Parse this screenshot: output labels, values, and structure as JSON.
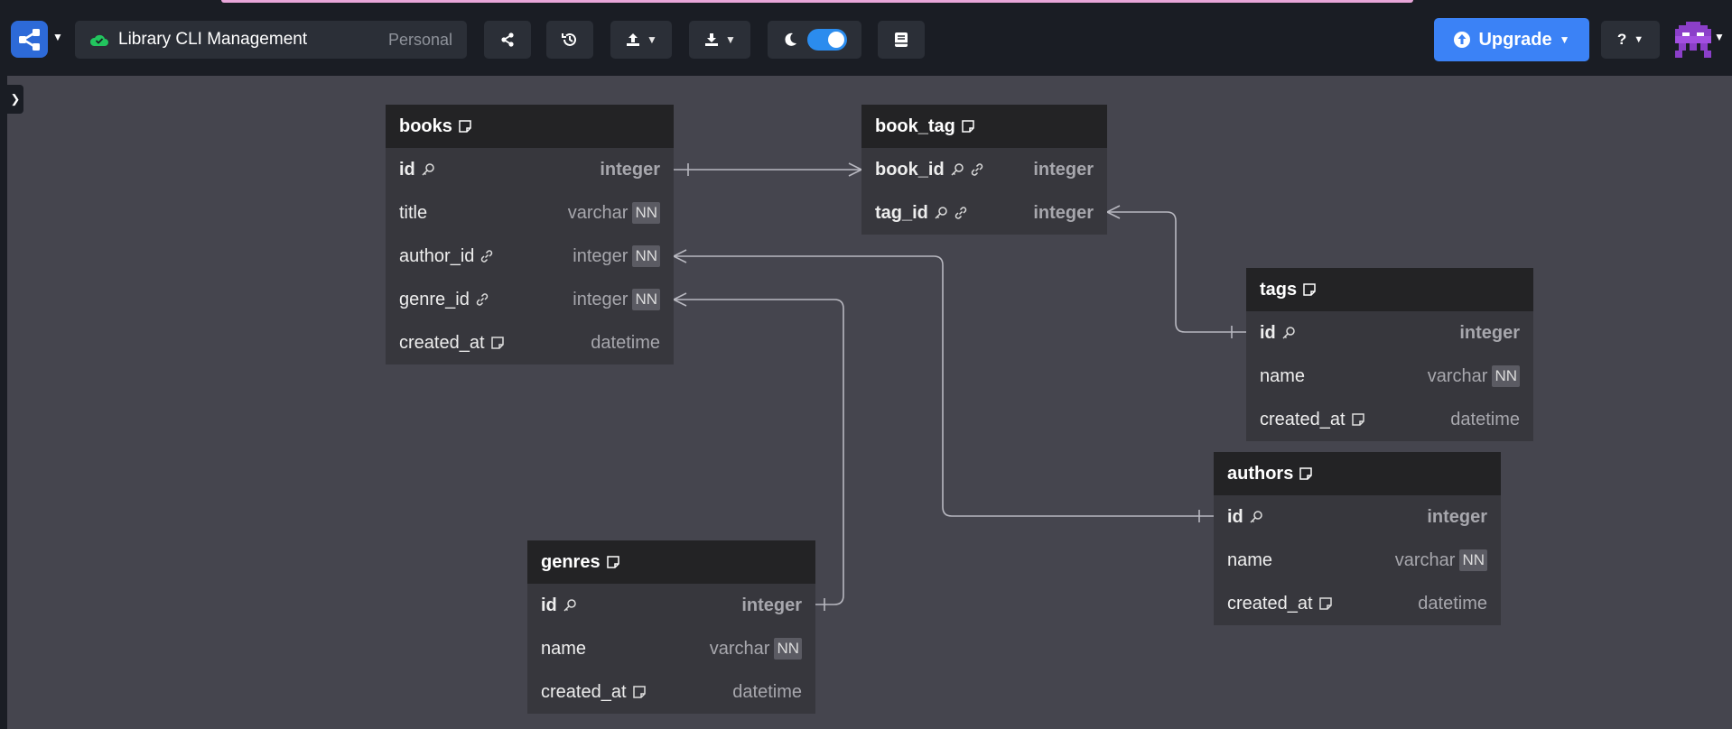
{
  "header": {
    "project_title": "Library CLI Management",
    "workspace": "Personal",
    "upgrade_label": "Upgrade",
    "help_label": "?",
    "accent_color": "#3b82f6",
    "sync_status_icon": "cloud-check-icon",
    "toolbar_icons": [
      "share-icon",
      "history-icon",
      "upload-icon",
      "download-icon",
      "moon-icon",
      "book-icon"
    ]
  },
  "tables": {
    "books": {
      "name": "books",
      "fields": [
        {
          "name": "id",
          "type": "integer",
          "nn": "",
          "icons": [
            "key-icon"
          ]
        },
        {
          "name": "title",
          "type": "varchar",
          "nn": "NN",
          "icons": []
        },
        {
          "name": "author_id",
          "type": "integer",
          "nn": "NN",
          "icons": [
            "link-icon"
          ]
        },
        {
          "name": "genre_id",
          "type": "integer",
          "nn": "NN",
          "icons": [
            "link-icon"
          ]
        },
        {
          "name": "created_at",
          "type": "datetime",
          "nn": "",
          "icons": [
            "note-icon"
          ]
        }
      ]
    },
    "book_tag": {
      "name": "book_tag",
      "fields": [
        {
          "name": "book_id",
          "type": "integer",
          "nn": "",
          "icons": [
            "key-icon",
            "link-icon"
          ]
        },
        {
          "name": "tag_id",
          "type": "integer",
          "nn": "",
          "icons": [
            "key-icon",
            "link-icon"
          ]
        }
      ]
    },
    "tags": {
      "name": "tags",
      "fields": [
        {
          "name": "id",
          "type": "integer",
          "nn": "",
          "icons": [
            "key-icon"
          ]
        },
        {
          "name": "name",
          "type": "varchar",
          "nn": "NN",
          "icons": []
        },
        {
          "name": "created_at",
          "type": "datetime",
          "nn": "",
          "icons": [
            "note-icon"
          ]
        }
      ]
    },
    "authors": {
      "name": "authors",
      "fields": [
        {
          "name": "id",
          "type": "integer",
          "nn": "",
          "icons": [
            "key-icon"
          ]
        },
        {
          "name": "name",
          "type": "varchar",
          "nn": "NN",
          "icons": []
        },
        {
          "name": "created_at",
          "type": "datetime",
          "nn": "",
          "icons": [
            "note-icon"
          ]
        }
      ]
    },
    "genres": {
      "name": "genres",
      "fields": [
        {
          "name": "id",
          "type": "integer",
          "nn": "",
          "icons": [
            "key-icon"
          ]
        },
        {
          "name": "name",
          "type": "varchar",
          "nn": "NN",
          "icons": []
        },
        {
          "name": "created_at",
          "type": "datetime",
          "nn": "",
          "icons": [
            "note-icon"
          ]
        }
      ]
    }
  }
}
